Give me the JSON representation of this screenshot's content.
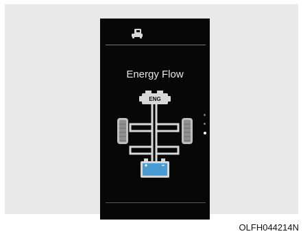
{
  "screen": {
    "top_icon": "vehicle-icon",
    "title": "Energy Flow",
    "diagram": {
      "engine_label": "ENG",
      "engine_icon": "engine-icon",
      "battery_icon": "battery-icon",
      "wheel_icon": "wheel-icon",
      "battery_color": "#4a9bd2"
    },
    "page_indicator": {
      "total_pages": 3,
      "active_page": 3
    }
  },
  "figure_code": "OLFH044214N"
}
